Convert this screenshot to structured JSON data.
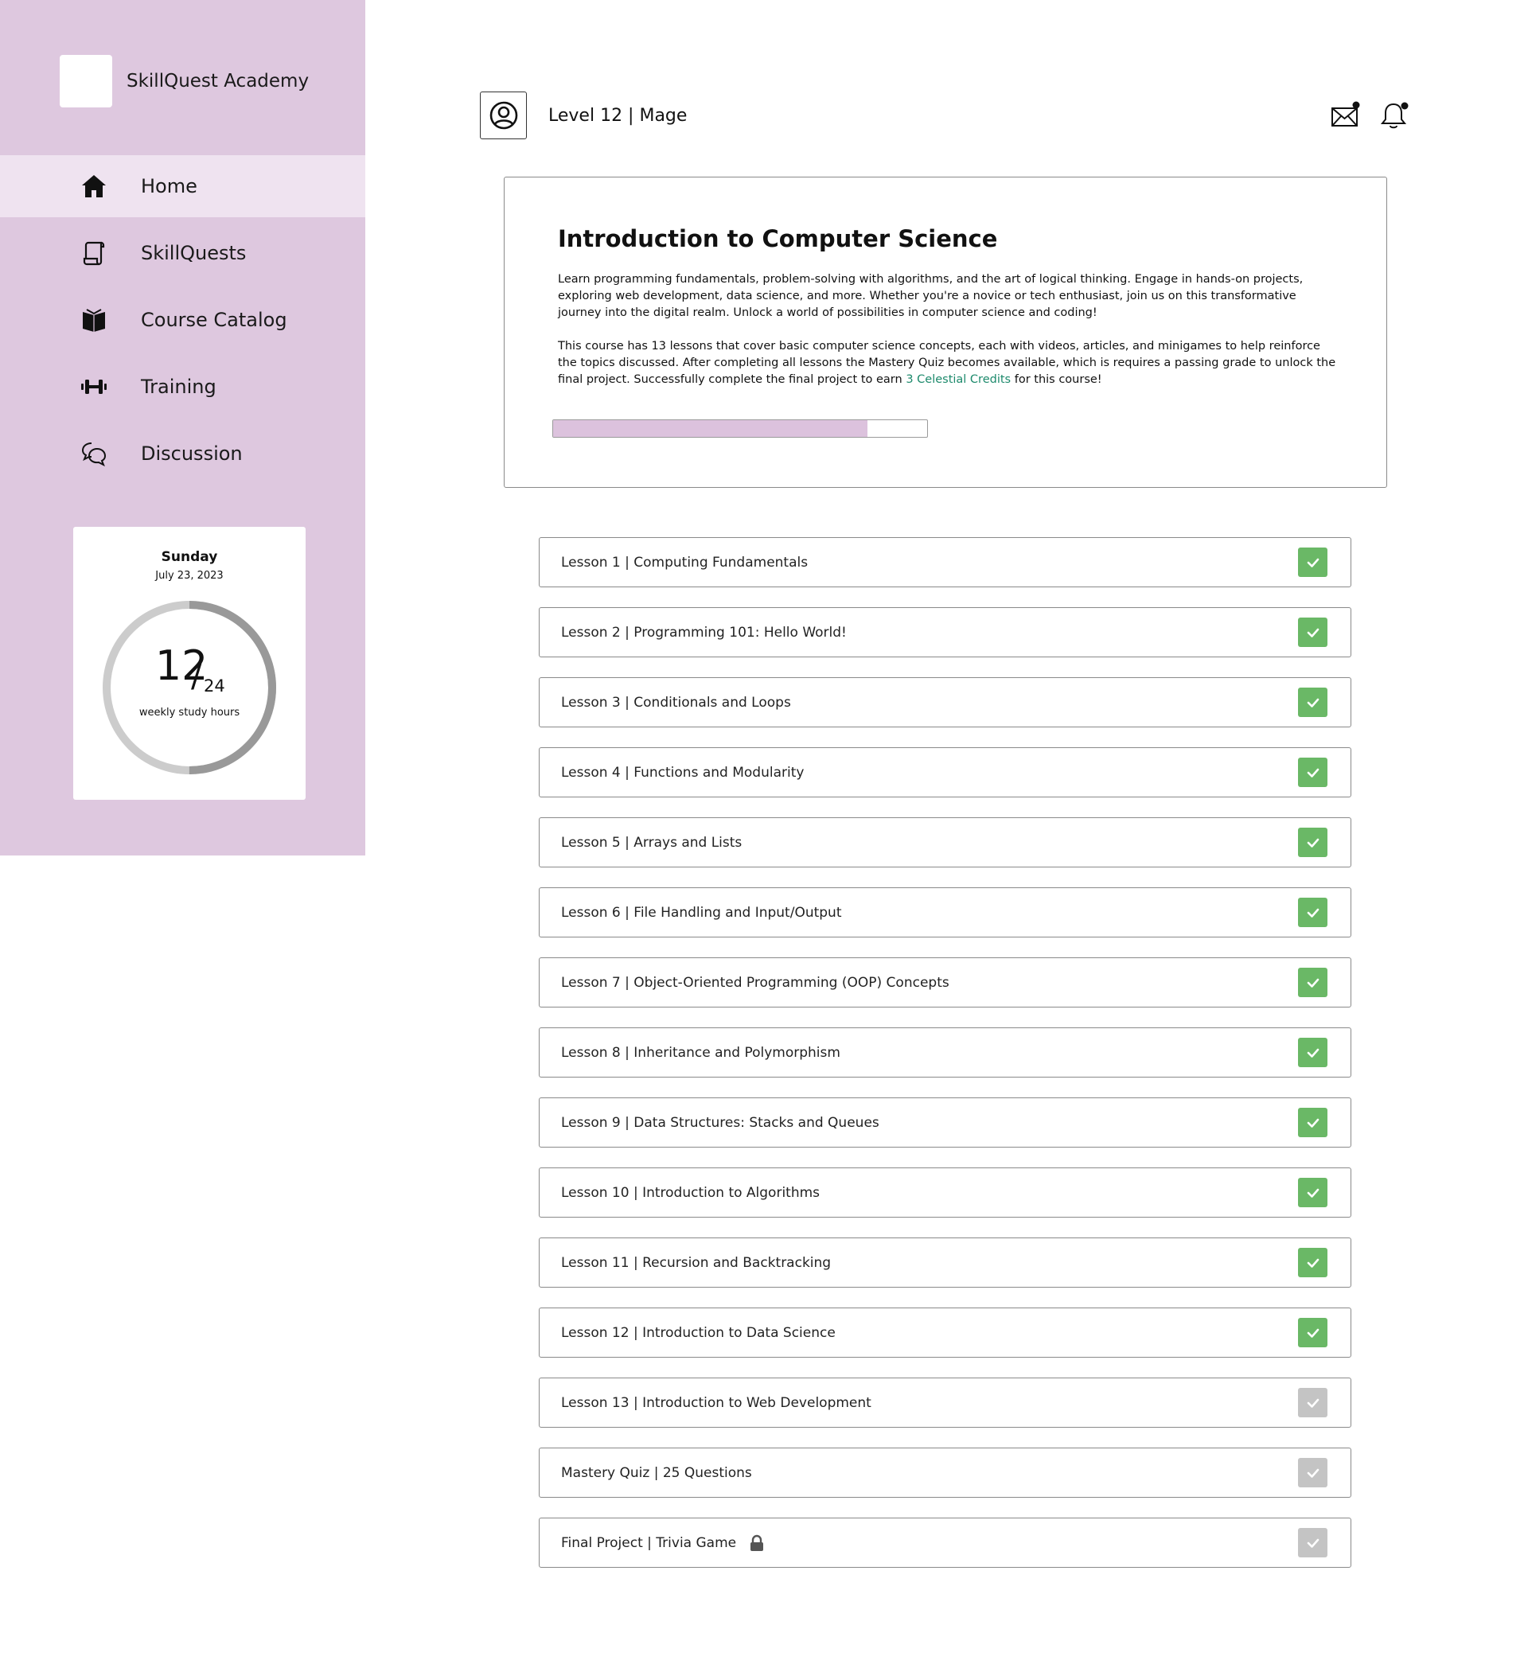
{
  "brand": {
    "name": "SkillQuest Academy"
  },
  "nav": [
    {
      "label": "Home",
      "icon": "home-icon",
      "active": true
    },
    {
      "label": "SkillQuests",
      "icon": "scroll-icon",
      "active": false
    },
    {
      "label": "Course Catalog",
      "icon": "book-icon",
      "active": false
    },
    {
      "label": "Training",
      "icon": "dumbbell-icon",
      "active": false
    },
    {
      "label": "Discussion",
      "icon": "chat-bubbles-icon",
      "active": false
    }
  ],
  "study": {
    "day": "Sunday",
    "date": "July 23, 2023",
    "hours": "12",
    "slash": "/",
    "goal": "24",
    "caption": "weekly study hours",
    "progress_fraction": 0.5
  },
  "header": {
    "level": "Level 12 | Mage",
    "mail_icon": "mail-icon",
    "bell_icon": "bell-icon",
    "avatar_icon": "user-avatar-icon"
  },
  "course": {
    "title": "Introduction to Computer Science",
    "description_1": "Learn programming fundamentals, problem-solving with algorithms, and the art of logical thinking. Engage in hands-on projects, exploring web development, data science, and more. Whether you're a novice or tech enthusiast, join us on this transformative journey into the digital realm. Unlock a world of possibilities in computer science and coding!",
    "description_2_before": "This course has 13 lessons that cover basic computer science concepts, each with videos, articles, and minigames to help reinforce the topics discussed. After completing all lessons the Mastery Quiz becomes available, which is requires a passing grade to unlock the final project. Successfully complete the final project to earn ",
    "credits": "3 Celestial Credits",
    "description_2_after": " for this course!",
    "progress_percent": 84,
    "accent_color": "#dcc2dd",
    "credits_color": "#1d8a6c"
  },
  "lessons": [
    {
      "label": "Lesson 1 | Computing Fundamentals",
      "status": "done",
      "locked": false
    },
    {
      "label": "Lesson 2 | Programming 101: Hello World!",
      "status": "done",
      "locked": false
    },
    {
      "label": "Lesson 3 | Conditionals and Loops",
      "status": "done",
      "locked": false
    },
    {
      "label": "Lesson 4 | Functions and Modularity",
      "status": "done",
      "locked": false
    },
    {
      "label": "Lesson 5 | Arrays and Lists",
      "status": "done",
      "locked": false
    },
    {
      "label": "Lesson 6 | File Handling and Input/Output",
      "status": "done",
      "locked": false
    },
    {
      "label": "Lesson 7 | Object-Oriented Programming (OOP) Concepts",
      "status": "done",
      "locked": false
    },
    {
      "label": "Lesson 8 | Inheritance and Polymorphism",
      "status": "done",
      "locked": false
    },
    {
      "label": "Lesson 9 | Data Structures: Stacks and Queues",
      "status": "done",
      "locked": false
    },
    {
      "label": "Lesson 10 | Introduction to Algorithms",
      "status": "done",
      "locked": false
    },
    {
      "label": "Lesson 11 | Recursion and Backtracking",
      "status": "done",
      "locked": false
    },
    {
      "label": "Lesson 12 | Introduction to Data Science",
      "status": "done",
      "locked": false
    },
    {
      "label": "Lesson 13 | Introduction to Web Development",
      "status": "pending",
      "locked": false
    },
    {
      "label": "Mastery Quiz | 25 Questions",
      "status": "pending",
      "locked": false
    },
    {
      "label": "Final Project | Trivia Game",
      "status": "pending",
      "locked": true
    }
  ],
  "colors": {
    "sidebar": "#dec8df",
    "sidebar_active": "#efe3f0",
    "check_done": "#6ab866",
    "check_pending": "#c4c4c4",
    "ring_done": "#999999",
    "ring_track": "#cccccc"
  }
}
